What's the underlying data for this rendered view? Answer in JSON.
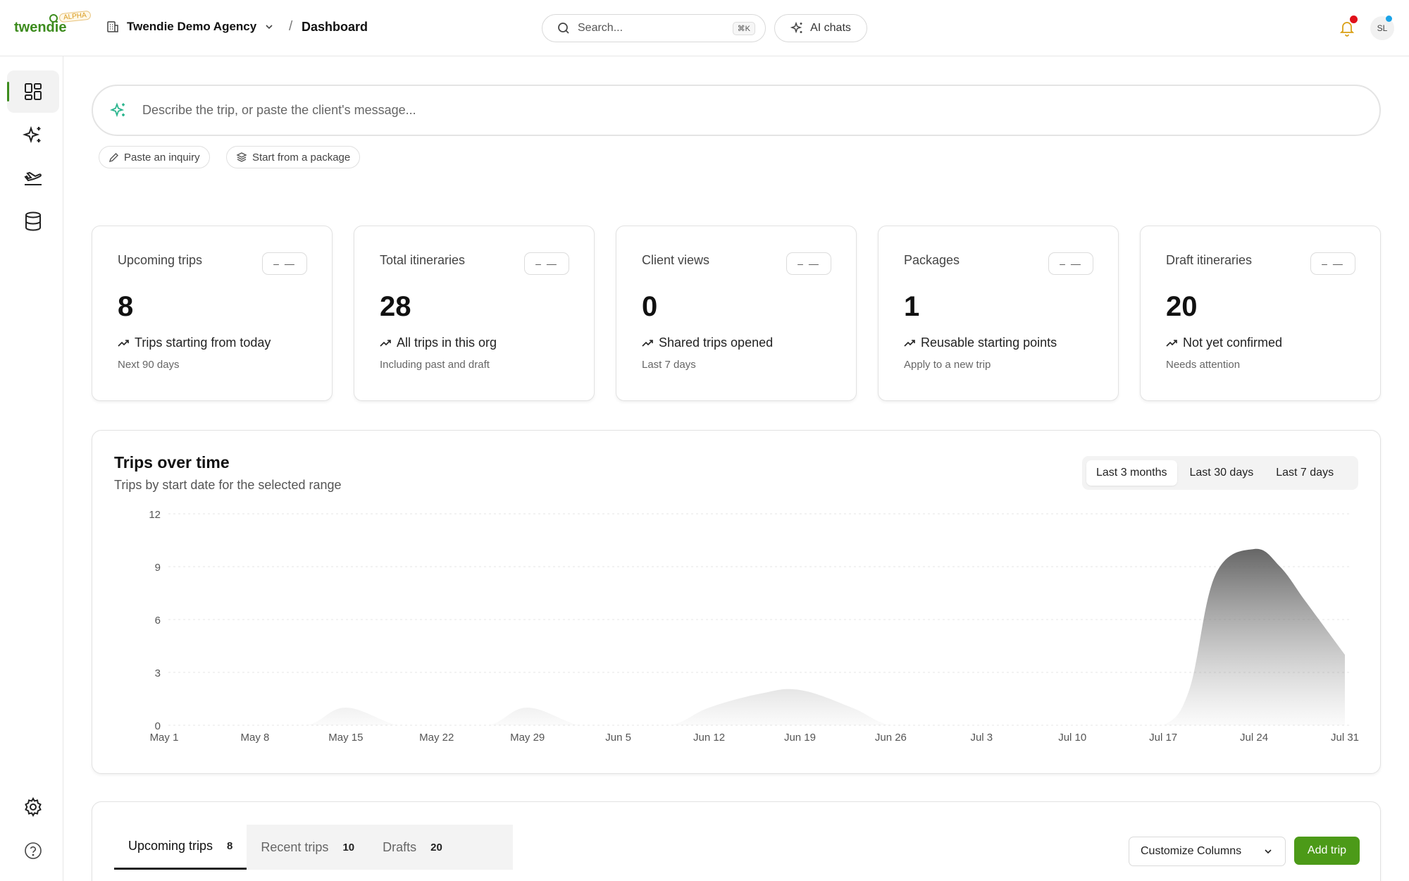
{
  "header": {
    "logo": "twendie",
    "badge": "ALPHA",
    "org_name": "Twendie Demo Agency",
    "breadcrumb_sep": "/",
    "breadcrumb": "Dashboard",
    "search_placeholder": "Search...",
    "search_shortcut": "⌘K",
    "ai_chats_label": "AI chats",
    "avatar_initials": "SL"
  },
  "sidebar": {
    "items": [
      {
        "icon": "dashboard-grid-icon",
        "active": true
      },
      {
        "icon": "sparkles-icon",
        "active": false
      },
      {
        "icon": "plane-departure-icon",
        "active": false
      },
      {
        "icon": "database-icon",
        "active": false
      }
    ],
    "bottom": [
      {
        "icon": "gear-icon"
      },
      {
        "icon": "help-circle-icon"
      }
    ]
  },
  "prompt": {
    "placeholder": "Describe the trip, or paste the client's message...",
    "chips": [
      "Paste an inquiry",
      "Start from a package"
    ]
  },
  "stats": [
    {
      "title": "Upcoming trips",
      "pill": "– —",
      "value": "8",
      "trend": "Trips starting from today",
      "sub": "Next 90 days"
    },
    {
      "title": "Total itineraries",
      "pill": "– —",
      "value": "28",
      "trend": "All trips in this org",
      "sub": "Including past and draft"
    },
    {
      "title": "Client views",
      "pill": "– —",
      "value": "0",
      "trend": "Shared trips opened",
      "sub": "Last 7 days"
    },
    {
      "title": "Packages",
      "pill": "– —",
      "value": "1",
      "trend": "Reusable starting points",
      "sub": "Apply to a new trip"
    },
    {
      "title": "Draft itineraries",
      "pill": "– —",
      "value": "20",
      "trend": "Not yet confirmed",
      "sub": "Needs attention"
    }
  ],
  "chart": {
    "title": "Trips over time",
    "subtitle": "Trips by start date for the selected range",
    "ranges": [
      "Last 3 months",
      "Last 30 days",
      "Last 7 days"
    ],
    "active_range": "Last 3 months"
  },
  "chart_data": {
    "type": "area",
    "title": "Trips over time",
    "subtitle": "Trips by start date for the selected range",
    "x_ticks": [
      "May 1",
      "May 8",
      "May 15",
      "May 22",
      "May 29",
      "Jun 5",
      "Jun 12",
      "Jun 19",
      "Jun 26",
      "Jul 3",
      "Jul 10",
      "Jul 17",
      "Jul 24",
      "Jul 31"
    ],
    "y_ticks": [
      0,
      3,
      6,
      9,
      12
    ],
    "ylim": [
      0,
      12
    ],
    "grid": true,
    "series": [
      {
        "x": [
          "May 1",
          "May 8",
          "May 12",
          "May 15",
          "May 19",
          "May 22",
          "May 26",
          "May 29",
          "Jun 2",
          "Jun 5",
          "Jun 9",
          "Jun 12",
          "Jun 16",
          "Jun 19",
          "Jun 23",
          "Jun 26",
          "Jun 30",
          "Jul 3",
          "Jul 7",
          "Jul 10",
          "Jul 14",
          "Jul 17",
          "Jul 19",
          "Jul 21",
          "Jul 24",
          "Jul 26",
          "Jul 28",
          "Jul 31"
        ],
        "values": [
          0,
          0,
          0,
          1,
          0,
          0,
          0,
          1,
          0,
          0,
          0,
          1,
          1.8,
          2,
          1,
          0,
          0,
          0,
          0,
          0,
          0,
          0,
          2,
          8.5,
          10,
          9,
          7,
          4
        ]
      }
    ]
  },
  "table": {
    "tabs": [
      {
        "label": "Upcoming trips",
        "count": "8"
      },
      {
        "label": "Recent trips",
        "count": "10"
      },
      {
        "label": "Drafts",
        "count": "20"
      }
    ],
    "customize_label": "Customize Columns",
    "add_label": "Add trip"
  },
  "colors": {
    "brand": "#3d8c1e",
    "primary_button": "#4c9a18",
    "notification": "#e0101a",
    "presence": "#1aa3e8"
  }
}
